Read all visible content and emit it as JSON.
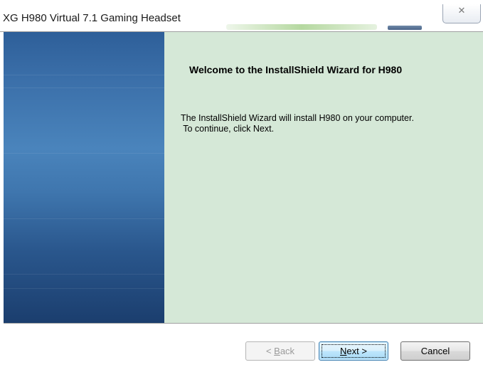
{
  "window": {
    "title": "XG H980 Virtual 7.1 Gaming Headset",
    "close_icon": "close-icon"
  },
  "wizard": {
    "heading": "Welcome to the InstallShield Wizard for H980",
    "body": "The InstallShield Wizard will install H980 on your computer.\n To continue, click Next."
  },
  "buttons": {
    "back": {
      "prefix": "< ",
      "mnemonic": "B",
      "rest": "ack",
      "enabled": false
    },
    "next": {
      "mnemonic": "N",
      "rest": "ext >",
      "enabled": true
    },
    "cancel": {
      "label": "Cancel",
      "enabled": true
    }
  },
  "colors": {
    "side_panel_top": "#2e5f99",
    "side_panel_bottom": "#1b3e6e",
    "main_panel_bg": "#d5e8d7"
  }
}
